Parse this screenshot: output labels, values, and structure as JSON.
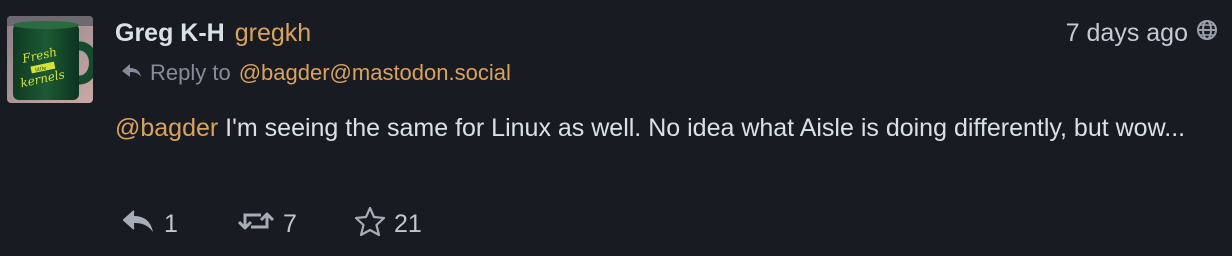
{
  "post": {
    "author": {
      "display_name": "Greg K-H",
      "handle": "gregkh",
      "avatar_text_line1": "Fresh",
      "avatar_text_line2": "little",
      "avatar_text_line3": "kernels"
    },
    "timestamp": "7 days ago",
    "visibility_icon": "globe-icon",
    "reply_to": {
      "label": "Reply to",
      "target": "@bagder@mastodon.social"
    },
    "content": {
      "mention": "@bagder",
      "text": " I'm seeing the same for Linux as well. No idea what Aisle is doing differently, but wow..."
    },
    "actions": {
      "replies": "1",
      "boosts": "7",
      "favourites": "21"
    }
  },
  "colors": {
    "background": "#191b22",
    "accent": "#d9a35e",
    "text": "#d9e1e8",
    "muted": "#868c99"
  }
}
